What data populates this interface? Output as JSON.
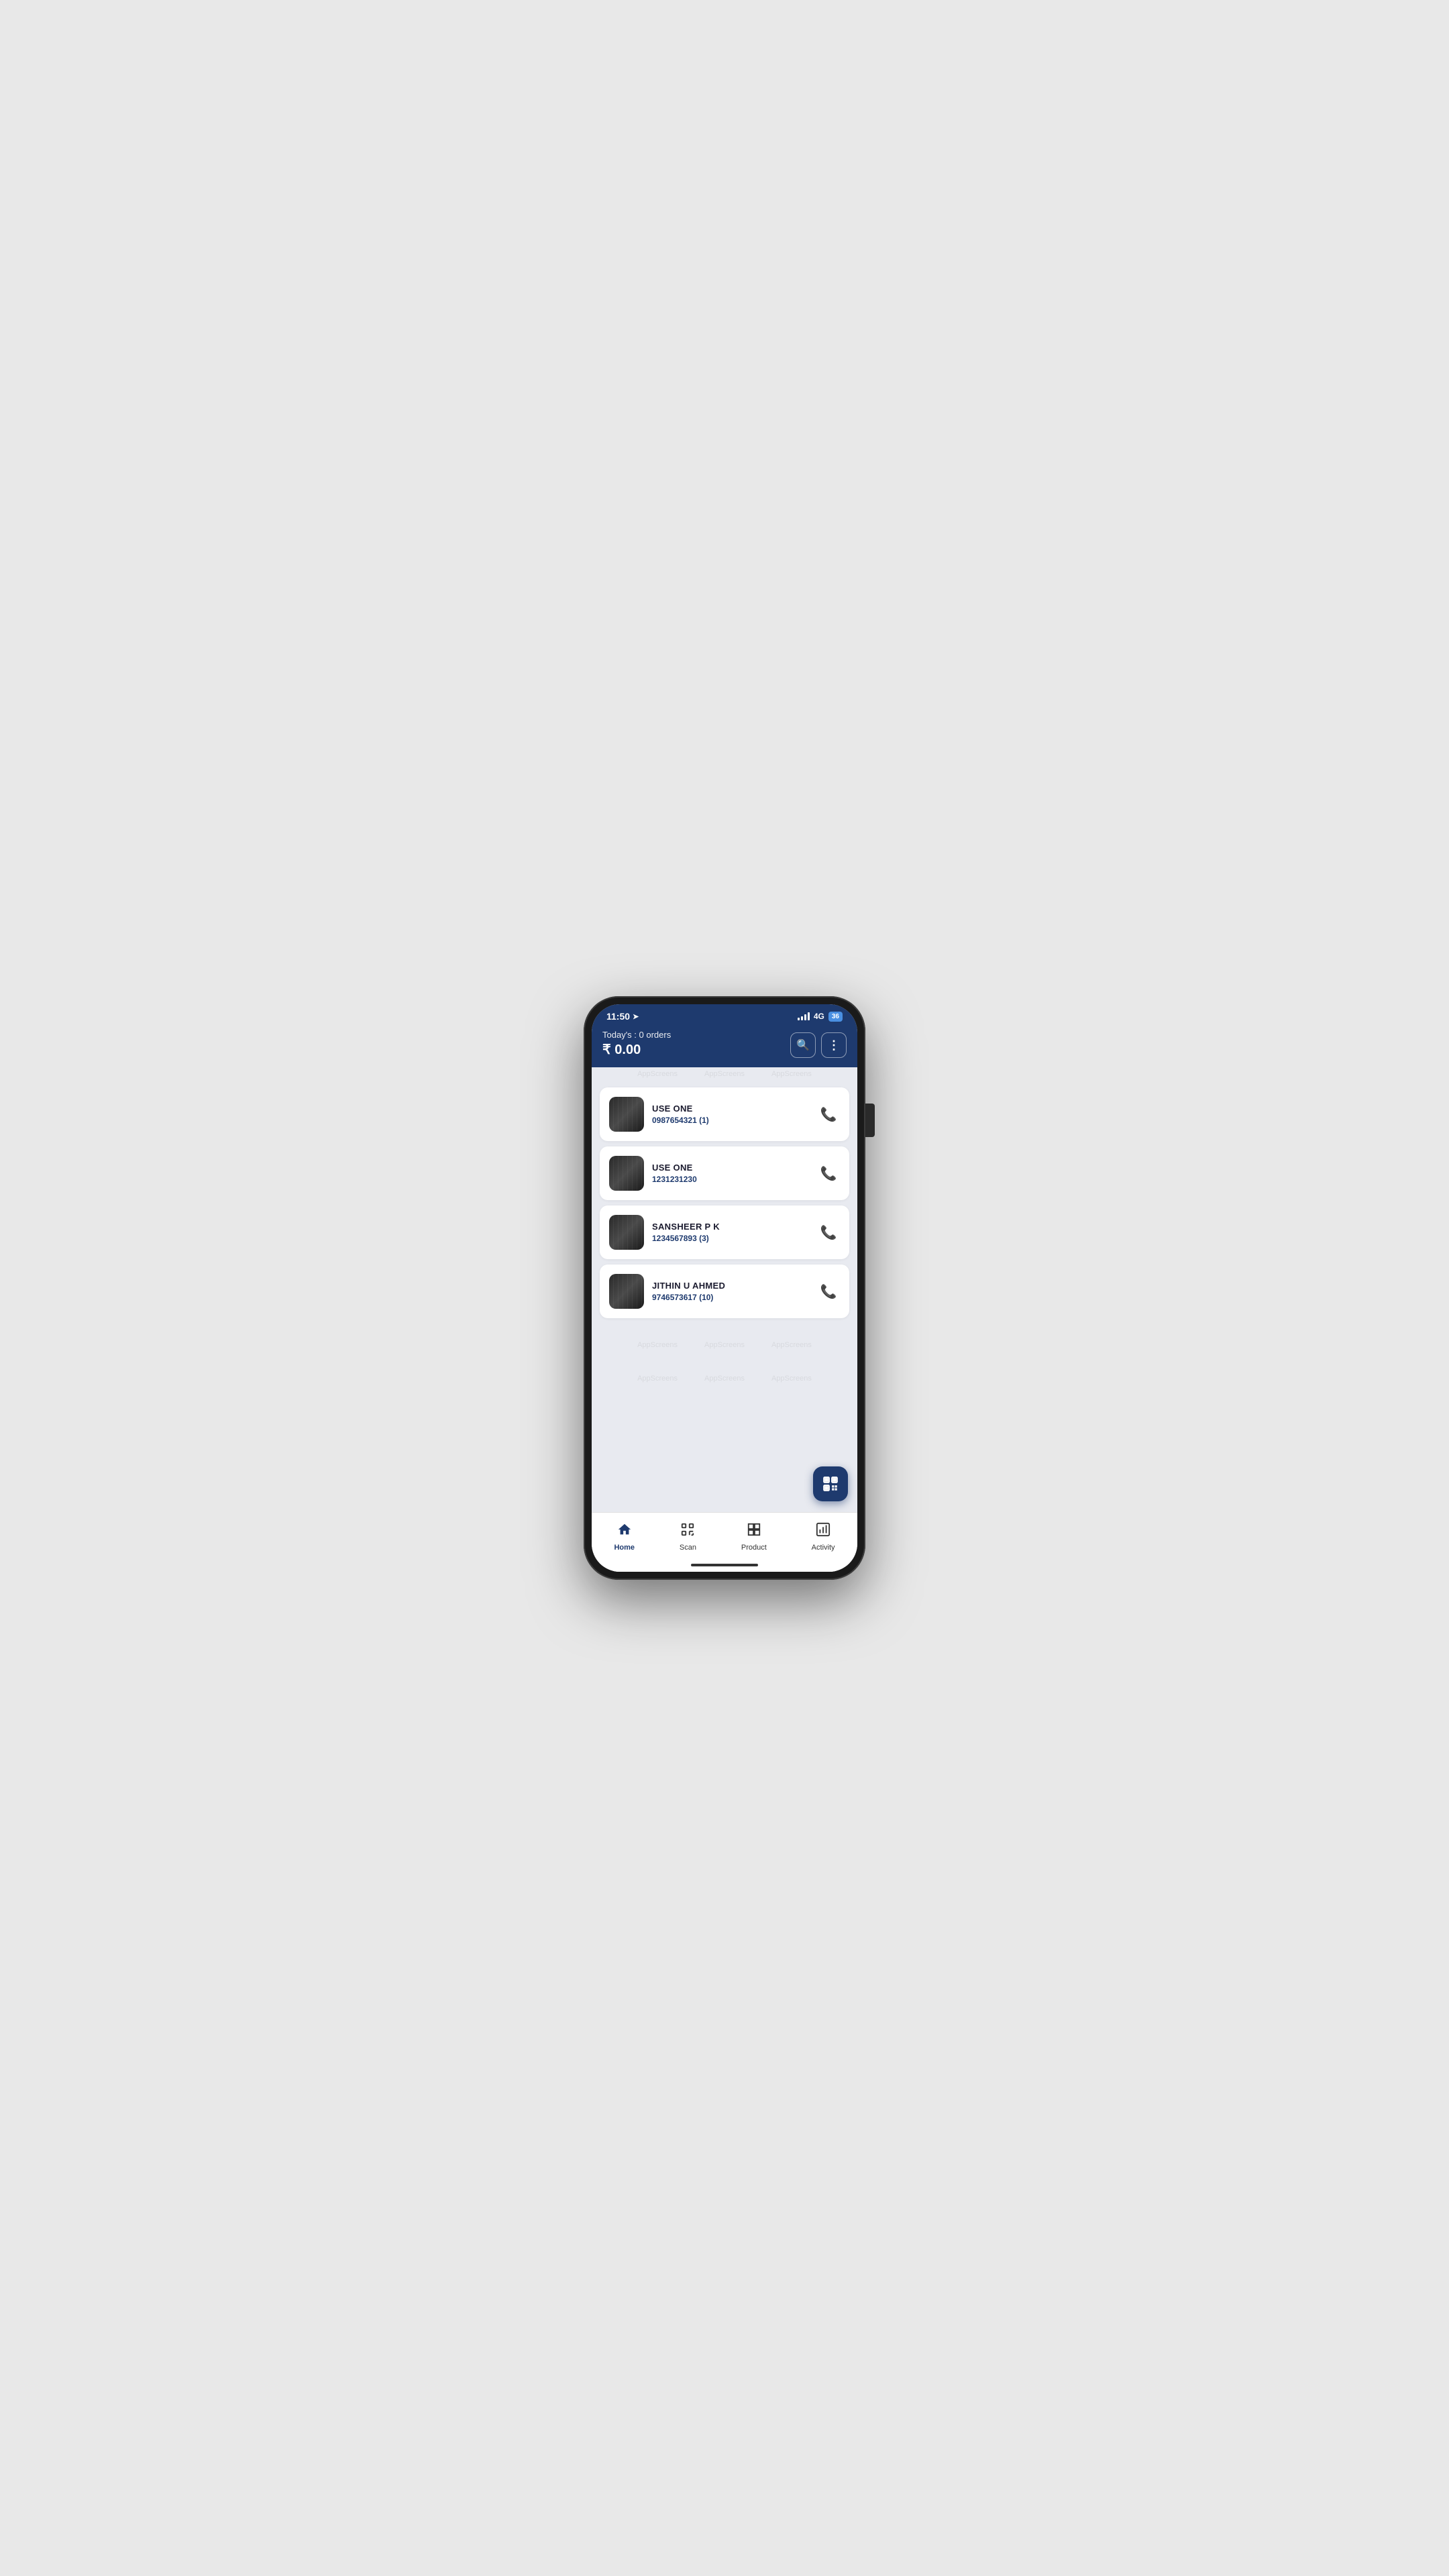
{
  "statusBar": {
    "time": "11:50",
    "network": "4G",
    "battery": "36"
  },
  "header": {
    "ordersLabel": "Today's : 0 orders",
    "amount": "₹ 0.00",
    "searchIconLabel": "🔍",
    "moreIconLabel": "⋮"
  },
  "customers": [
    {
      "name": "USE ONE",
      "phone": "0987654321 (1)"
    },
    {
      "name": "USE ONE",
      "phone": "1231231230"
    },
    {
      "name": "SANSHEER P K",
      "phone": "1234567893 (3)"
    },
    {
      "name": "JITHIN U AHMED",
      "phone": "9746573617 (10)"
    }
  ],
  "watermarks": [
    "AppScreens",
    "AppScreens",
    "AppScreens"
  ],
  "bottomNav": [
    {
      "id": "home",
      "label": "Home",
      "icon": "🏠",
      "active": true
    },
    {
      "id": "scan",
      "label": "Scan",
      "icon": "⬚",
      "active": false
    },
    {
      "id": "product",
      "label": "Product",
      "icon": "▦",
      "active": false
    },
    {
      "id": "activity",
      "label": "Activity",
      "icon": "📊",
      "active": false
    }
  ],
  "fab": {
    "icon": "⊞",
    "label": "qr-scan-fab"
  }
}
